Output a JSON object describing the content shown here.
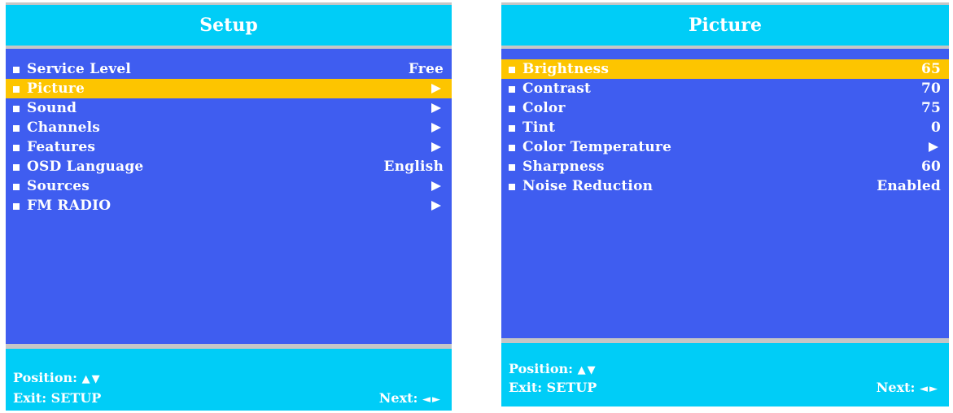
{
  "setup_menu": {
    "title": "Setup",
    "items": [
      {
        "label": "Service Level",
        "value": "Free"
      },
      {
        "label": "Picture",
        "value": "",
        "submenu": true,
        "selected": true
      },
      {
        "label": "Sound",
        "value": "",
        "submenu": true
      },
      {
        "label": "Channels",
        "value": "",
        "submenu": true
      },
      {
        "label": "Features",
        "value": "",
        "submenu": true
      },
      {
        "label": "OSD Language",
        "value": "English"
      },
      {
        "label": "Sources",
        "value": "",
        "submenu": true
      },
      {
        "label": "FM RADIO",
        "value": "",
        "submenu": true
      }
    ],
    "footer": {
      "position_label": "Position:",
      "position_glyphs": "▲▼",
      "exit_label": "Exit: SETUP",
      "next_label": "Next:",
      "next_glyphs": "◄►"
    }
  },
  "picture_menu": {
    "title": "Picture",
    "items": [
      {
        "label": "Brightness",
        "value": "65",
        "selected": true
      },
      {
        "label": "Contrast",
        "value": "70"
      },
      {
        "label": "Color",
        "value": "75"
      },
      {
        "label": "Tint",
        "value": "0"
      },
      {
        "label": "Color Temperature",
        "value": "",
        "submenu": true
      },
      {
        "label": "Sharpness",
        "value": "60"
      },
      {
        "label": "Noise Reduction",
        "value": "Enabled"
      }
    ],
    "footer": {
      "position_label": "Position:",
      "position_glyphs": "▲▼",
      "exit_label": "Exit: SETUP",
      "next_label": "Next:",
      "next_glyphs": "◄►"
    }
  },
  "colors": {
    "menu_body": "#3f5df0",
    "header_footer": "#00cdf7",
    "selection": "#fdc500",
    "divider": "#c6c6c6",
    "text": "#ffffff"
  }
}
